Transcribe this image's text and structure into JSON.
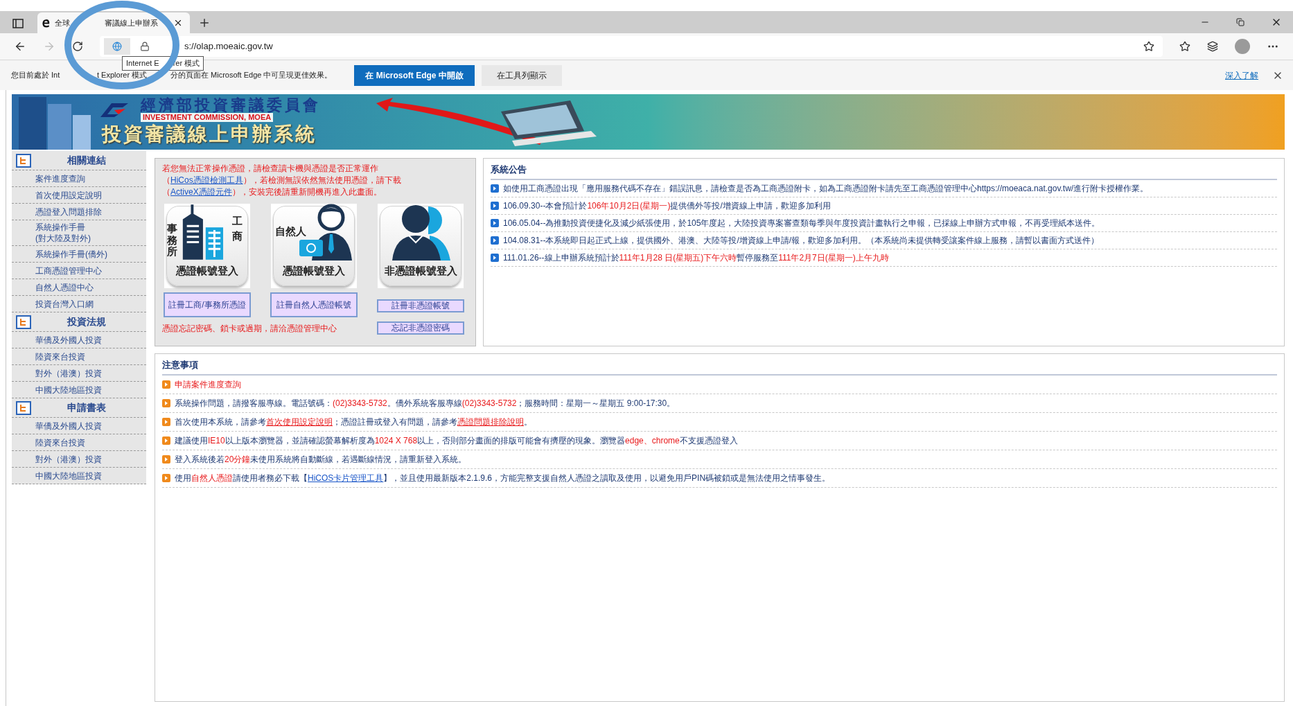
{
  "browser": {
    "tab_title_parts": [
      "全球",
      "審議線上申辦系"
    ],
    "url": "s://olap.moeaic.gov.tw",
    "tooltip_parts": [
      "Internet E",
      "rer 模式"
    ],
    "info_bar": {
      "message_parts": [
        "您目前處於 Int",
        "t Explorer 模式",
        "分的頁面在 Microsoft Edge 中可呈現更佳效果。"
      ],
      "open_button": "在 Microsoft Edge 中開啟",
      "toolbar_button": "在工具列顯示",
      "learn_more": "深入了解"
    }
  },
  "banner": {
    "org_name": "經濟部投資審議委員會",
    "org_english": "INVESTMENT COMMISSION, MOEA",
    "system_name": "投資審議線上申辦系統"
  },
  "sidebar": {
    "sections": [
      {
        "title": "相關連結",
        "items": [
          "案件進度查詢",
          "首次使用設定說明",
          "憑證登入問題排除",
          "系統操作手冊\n(對大陸及對外)",
          "系統操作手冊(僑外)",
          "工商憑證管理中心",
          "自然人憑證中心",
          "投資台灣入口網"
        ]
      },
      {
        "title": "投資法規",
        "items": [
          "華僑及外國人投資",
          "陸資來台投資",
          "對外（港澳）投資",
          "中國大陸地區投資"
        ]
      },
      {
        "title": "申請書表",
        "items": [
          "華僑及外國人投資",
          "陸資來台投資",
          "對外（港澳）投資",
          "中國大陸地區投資"
        ]
      }
    ]
  },
  "login_panel": {
    "warning": [
      {
        "kind": "text",
        "text": "若您無法正常操作憑證，請檢查讀卡機與憑證是否正常運作（"
      },
      {
        "kind": "link",
        "text": "HiCos憑證檢測工具"
      },
      {
        "kind": "text",
        "text": "），若檢測無誤依然無法使用憑證，請下載（"
      },
      {
        "kind": "link",
        "text": "ActiveX憑證元件"
      },
      {
        "kind": "text",
        "text": "），安裝完後請重新開機再進入此畫面。"
      }
    ],
    "tiles": [
      {
        "kind": "company",
        "labels": [
          "事務所",
          "工商"
        ],
        "caption": "憑證帳號登入",
        "register": "註冊工商/事務所憑證"
      },
      {
        "kind": "citizen",
        "labels": [
          "自然人"
        ],
        "caption": "憑證帳號登入",
        "register": "註冊自然人憑證帳號"
      },
      {
        "kind": "plain",
        "caption": "非憑證帳號登入",
        "register": "註冊非憑證帳號"
      }
    ],
    "forgot_note": "憑證忘記密碼、鎖卡或過期，請洽憑證管理中心",
    "forgot_button": "忘記非憑證密碼"
  },
  "announcements": {
    "title": "系統公告",
    "items": [
      [
        {
          "kind": "text",
          "text": "如使用工商憑證出現「應用服務代碼不存在」錯誤訊息，請檢查是否為工商憑證附卡，如為工商憑證附卡請先至工商憑證管理中心https://moeaca.nat.gov.tw/進行附卡授權作業。"
        }
      ],
      [
        {
          "kind": "text",
          "text": "106.09.30--本會預計於"
        },
        {
          "kind": "red",
          "text": "106年10月2日(星期一)"
        },
        {
          "kind": "text",
          "text": "提供僑外等投/增資線上申請，歡迎多加利用"
        }
      ],
      [
        {
          "kind": "text",
          "text": "106.05.04--為推動投資便捷化及減少紙張使用，於105年度起，大陸投資專案審查類每季與年度投資計畫執行之申報，已採線上申辦方式申報，不再受理紙本送件。"
        }
      ],
      [
        {
          "kind": "text",
          "text": "104.08.31--本系統即日起正式上線，提供國外、港澳、大陸等投/增資線上申請/報，歡迎多加利用。（本系統尚未提供轉受讓案件線上服務，請暫以書面方式送件）"
        }
      ],
      [
        {
          "kind": "text",
          "text": "111.01.26--線上申辦系統預計於"
        },
        {
          "kind": "red",
          "text": "111年1月28 日(星期五)下午六時"
        },
        {
          "kind": "text",
          "text": "暫停服務至"
        },
        {
          "kind": "red",
          "text": "111年2月7日(星期一)上午九時"
        }
      ]
    ]
  },
  "notices": {
    "title": "注意事項",
    "items": [
      [
        {
          "kind": "red",
          "text": "申請案件進度查詢"
        }
      ],
      [
        {
          "kind": "text",
          "text": "系統操作問題，請撥客服專線。電話號碼："
        },
        {
          "kind": "red",
          "text": "(02)3343-5732"
        },
        {
          "kind": "text",
          "text": "。僑外系統客服專線"
        },
        {
          "kind": "red",
          "text": "(02)3343-5732"
        },
        {
          "kind": "text",
          "text": "；服務時間：星期一～星期五 9:00-17:30。"
        }
      ],
      [
        {
          "kind": "text",
          "text": "首次使用本系統，請參考"
        },
        {
          "kind": "redlink",
          "text": "首次使用設定說明"
        },
        {
          "kind": "text",
          "text": "；憑證註冊或登入有問題，請參考"
        },
        {
          "kind": "redlink",
          "text": "憑證問題排除說明"
        },
        {
          "kind": "text",
          "text": "。"
        }
      ],
      [
        {
          "kind": "text",
          "text": "建議使用"
        },
        {
          "kind": "red",
          "text": "IE10"
        },
        {
          "kind": "text",
          "text": "以上版本瀏覽器，並請確認螢幕解析度為"
        },
        {
          "kind": "red",
          "text": "1024 X 768"
        },
        {
          "kind": "text",
          "text": "以上，否則部分畫面的排版可能會有擠壓的現象。瀏覽器"
        },
        {
          "kind": "red",
          "text": "edge、chrome"
        },
        {
          "kind": "text",
          "text": "不支援憑證登入"
        }
      ],
      [
        {
          "kind": "text",
          "text": "登入系統後若"
        },
        {
          "kind": "red",
          "text": "20分鐘"
        },
        {
          "kind": "text",
          "text": "未使用系統將自動斷線，若遇斷線情況，請重新登入系統。"
        }
      ],
      [
        {
          "kind": "text",
          "text": "使用"
        },
        {
          "kind": "red",
          "text": "自然人憑證"
        },
        {
          "kind": "text",
          "text": "請使用者務必下載【"
        },
        {
          "kind": "link",
          "text": "HiCOS卡片管理工具"
        },
        {
          "kind": "text",
          "text": "】，並且使用最新版本2.1.9.6，方能完整支援自然人憑證之讀取及使用，以避免用戶PIN碼被鎖或是無法使用之情事發生。"
        }
      ]
    ]
  }
}
